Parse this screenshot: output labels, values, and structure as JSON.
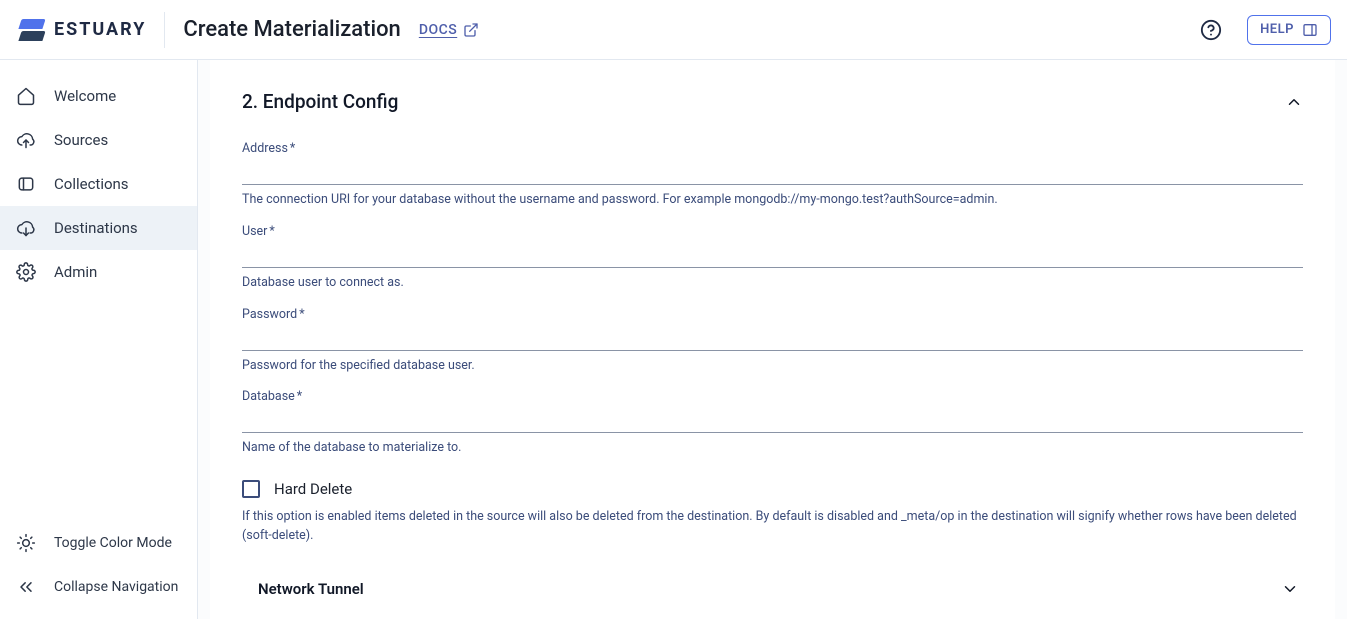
{
  "brand": {
    "name": "ESTUARY"
  },
  "header": {
    "title": "Create Materialization",
    "docs_label": "DOCS",
    "help_label": "HELP"
  },
  "sidebar": {
    "items": [
      {
        "label": "Welcome"
      },
      {
        "label": "Sources"
      },
      {
        "label": "Collections"
      },
      {
        "label": "Destinations"
      },
      {
        "label": "Admin"
      }
    ],
    "bottom": [
      {
        "label": "Toggle Color Mode"
      },
      {
        "label": "Collapse Navigation"
      }
    ]
  },
  "section": {
    "title": "2. Endpoint Config",
    "fields": {
      "address": {
        "label": "Address",
        "required": "*",
        "value": "",
        "help": "The connection URI for your database without the username and password. For example mongodb://my-mongo.test?authSource=admin."
      },
      "user": {
        "label": "User",
        "required": "*",
        "value": "",
        "help": "Database user to connect as."
      },
      "password": {
        "label": "Password",
        "required": "*",
        "value": "",
        "help": "Password for the specified database user."
      },
      "database": {
        "label": "Database",
        "required": "*",
        "value": "",
        "help": "Name of the database to materialize to."
      }
    },
    "hard_delete": {
      "label": "Hard Delete",
      "help": "If this option is enabled items deleted in the source will also be deleted from the destination. By default is disabled and _meta/op in the destination will signify whether rows have been deleted (soft-delete)."
    },
    "network_tunnel": {
      "label": "Network Tunnel"
    }
  }
}
